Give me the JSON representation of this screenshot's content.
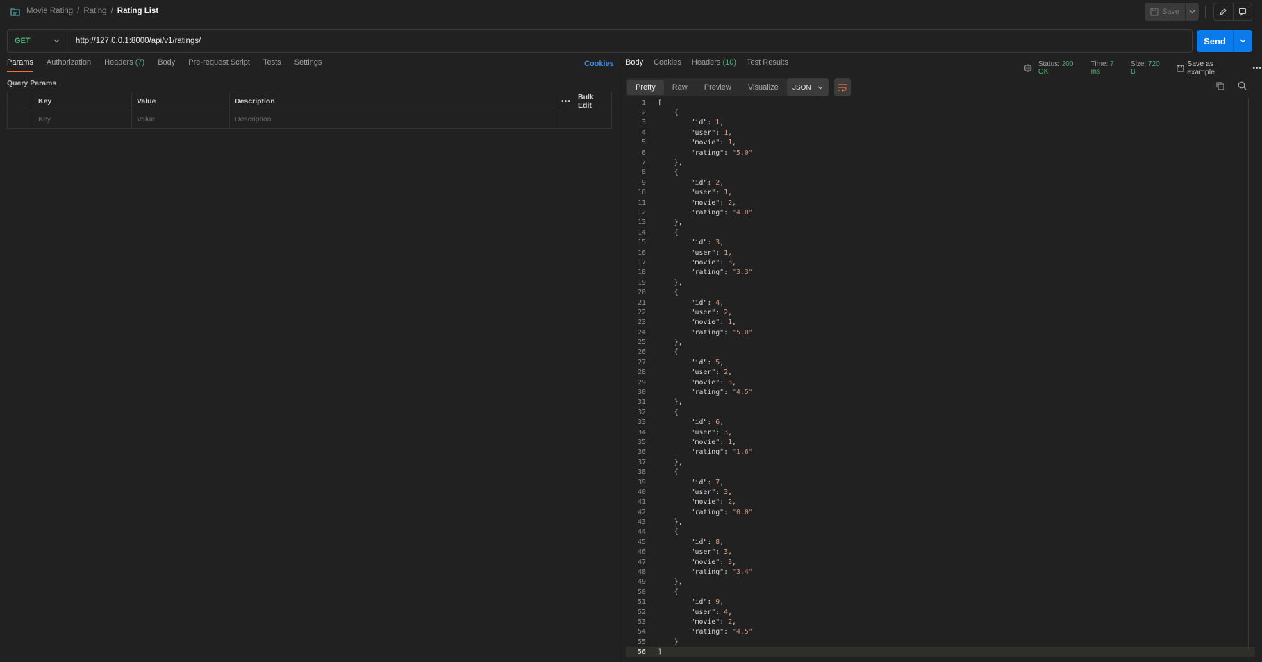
{
  "breadcrumb": {
    "items": [
      "Movie Rating",
      "Rating"
    ],
    "current": "Rating List"
  },
  "toolbar": {
    "save_label": "Save"
  },
  "request": {
    "method": "GET",
    "url": "http://127.0.0.1:8000/api/v1/ratings/",
    "send_label": "Send"
  },
  "request_tabs": {
    "params": "Params",
    "authorization": "Authorization",
    "headers": "Headers",
    "headers_count": "(7)",
    "body": "Body",
    "prerequest": "Pre-request Script",
    "tests": "Tests",
    "settings": "Settings",
    "cookies": "Cookies"
  },
  "query_params": {
    "title": "Query Params",
    "headers": {
      "key": "Key",
      "value": "Value",
      "description": "Description",
      "bulk_edit": "Bulk Edit"
    },
    "placeholders": {
      "key": "Key",
      "value": "Value",
      "description": "Description"
    }
  },
  "response_tabs": {
    "body": "Body",
    "cookies": "Cookies",
    "headers": "Headers",
    "headers_count": "(10)",
    "test_results": "Test Results"
  },
  "response_meta": {
    "status_label": "Status:",
    "status_value": "200 OK",
    "time_label": "Time:",
    "time_value": "7 ms",
    "size_label": "Size:",
    "size_value": "720 B",
    "save_example": "Save as example"
  },
  "response_view": {
    "modes": [
      "Pretty",
      "Raw",
      "Preview",
      "Visualize"
    ],
    "active_mode": "Pretty",
    "format": "JSON"
  },
  "response_body": [
    {
      "id": 1,
      "user": 1,
      "movie": 1,
      "rating": "5.0"
    },
    {
      "id": 2,
      "user": 1,
      "movie": 2,
      "rating": "4.0"
    },
    {
      "id": 3,
      "user": 1,
      "movie": 3,
      "rating": "3.3"
    },
    {
      "id": 4,
      "user": 2,
      "movie": 1,
      "rating": "5.0"
    },
    {
      "id": 5,
      "user": 2,
      "movie": 3,
      "rating": "4.5"
    },
    {
      "id": 6,
      "user": 3,
      "movie": 1,
      "rating": "1.6"
    },
    {
      "id": 7,
      "user": 3,
      "movie": 2,
      "rating": "0.0"
    },
    {
      "id": 8,
      "user": 3,
      "movie": 3,
      "rating": "3.4"
    },
    {
      "id": 9,
      "user": 4,
      "movie": 2,
      "rating": "4.5"
    }
  ],
  "colors": {
    "accent": "#ff6c37",
    "send": "#097bed",
    "status_ok": "#4fb179",
    "link": "#3a8fe8"
  }
}
